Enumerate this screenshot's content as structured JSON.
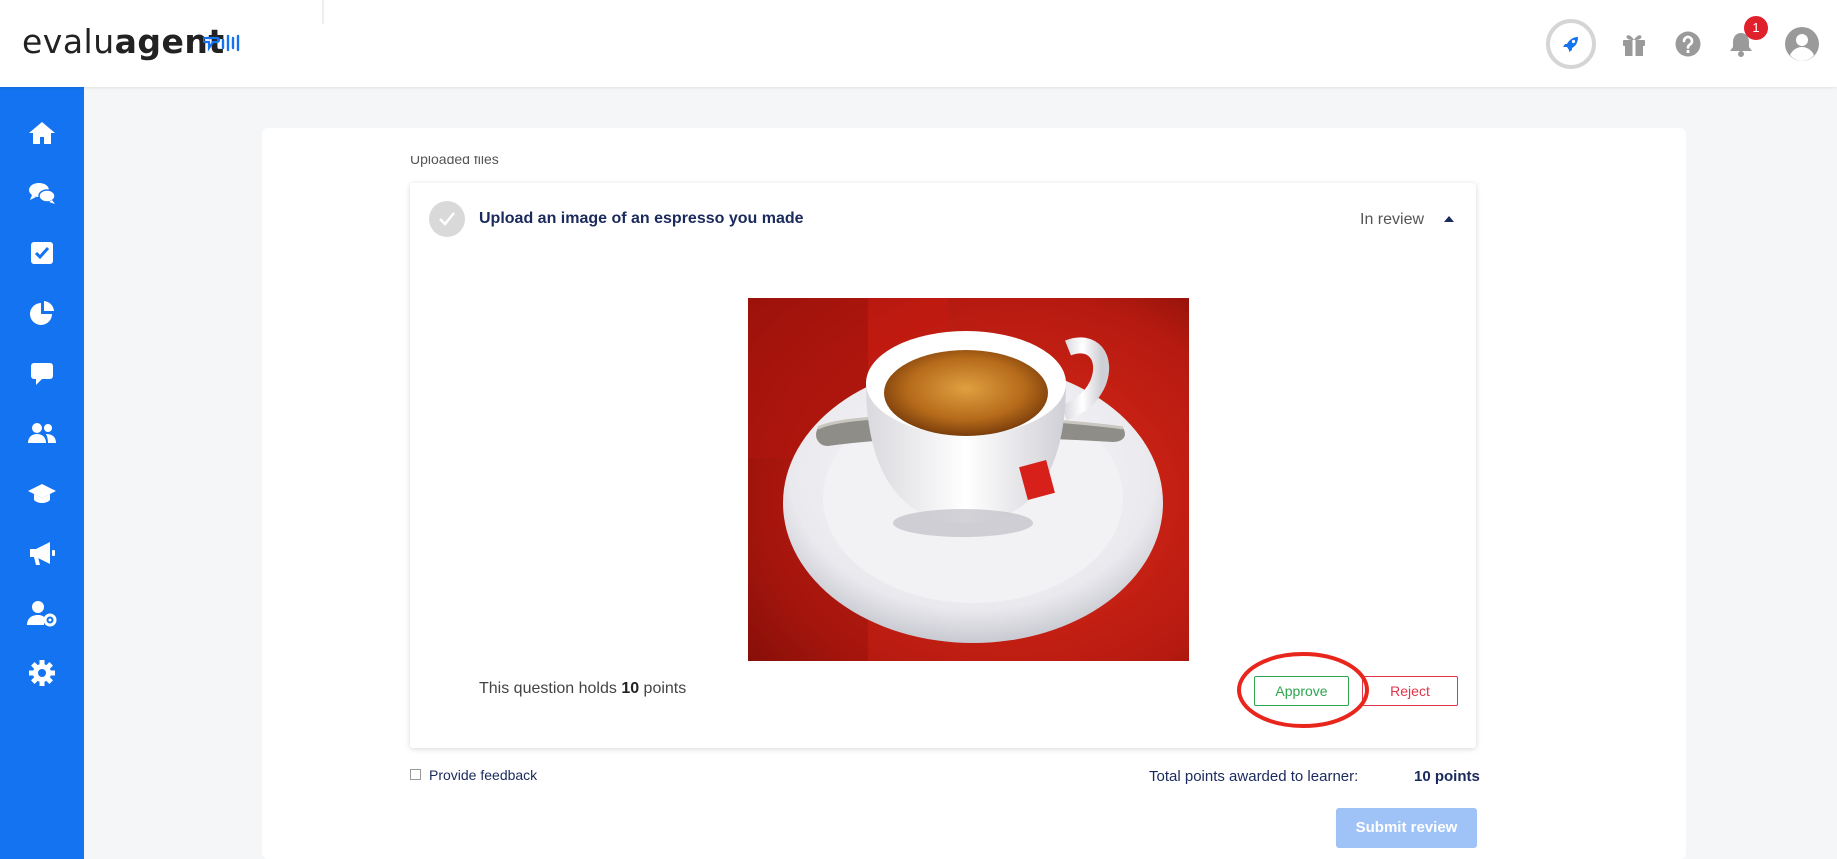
{
  "header": {
    "logo_light": "evalu",
    "logo_bold": "agent",
    "notification_count": "1",
    "icons": [
      "rocket-icon",
      "gift-icon",
      "help-icon",
      "bell-icon",
      "user-avatar-icon"
    ]
  },
  "sidebar": {
    "items": [
      {
        "name": "home",
        "icon": "home-icon"
      },
      {
        "name": "conversations",
        "icon": "chat-bubbles-icon"
      },
      {
        "name": "tasks",
        "icon": "checkbox-icon"
      },
      {
        "name": "reports",
        "icon": "pie-chart-icon"
      },
      {
        "name": "messages",
        "icon": "comment-icon"
      },
      {
        "name": "teams",
        "icon": "users-icon"
      },
      {
        "name": "learning",
        "icon": "graduation-cap-icon"
      },
      {
        "name": "announcements",
        "icon": "megaphone-icon"
      },
      {
        "name": "user-settings",
        "icon": "user-cog-icon"
      },
      {
        "name": "settings",
        "icon": "gear-icon"
      }
    ]
  },
  "main": {
    "section_label": "Uploaded files",
    "question": {
      "title": "Upload an image of an espresso you made",
      "status": "In review",
      "holds_prefix": "This question holds ",
      "holds_points": "10",
      "holds_suffix": " points",
      "approve_label": "Approve",
      "reject_label": "Reject"
    },
    "feedback_label": "Provide feedback",
    "total_label": "Total points awarded to learner:",
    "total_value": "10 points",
    "submit_label": "Submit review"
  },
  "colors": {
    "sidebar": "#1473f0",
    "approve": "#2ea44f",
    "reject": "#e0354a",
    "submit_disabled": "#9fc2f7",
    "annotation": "#e8261b"
  }
}
